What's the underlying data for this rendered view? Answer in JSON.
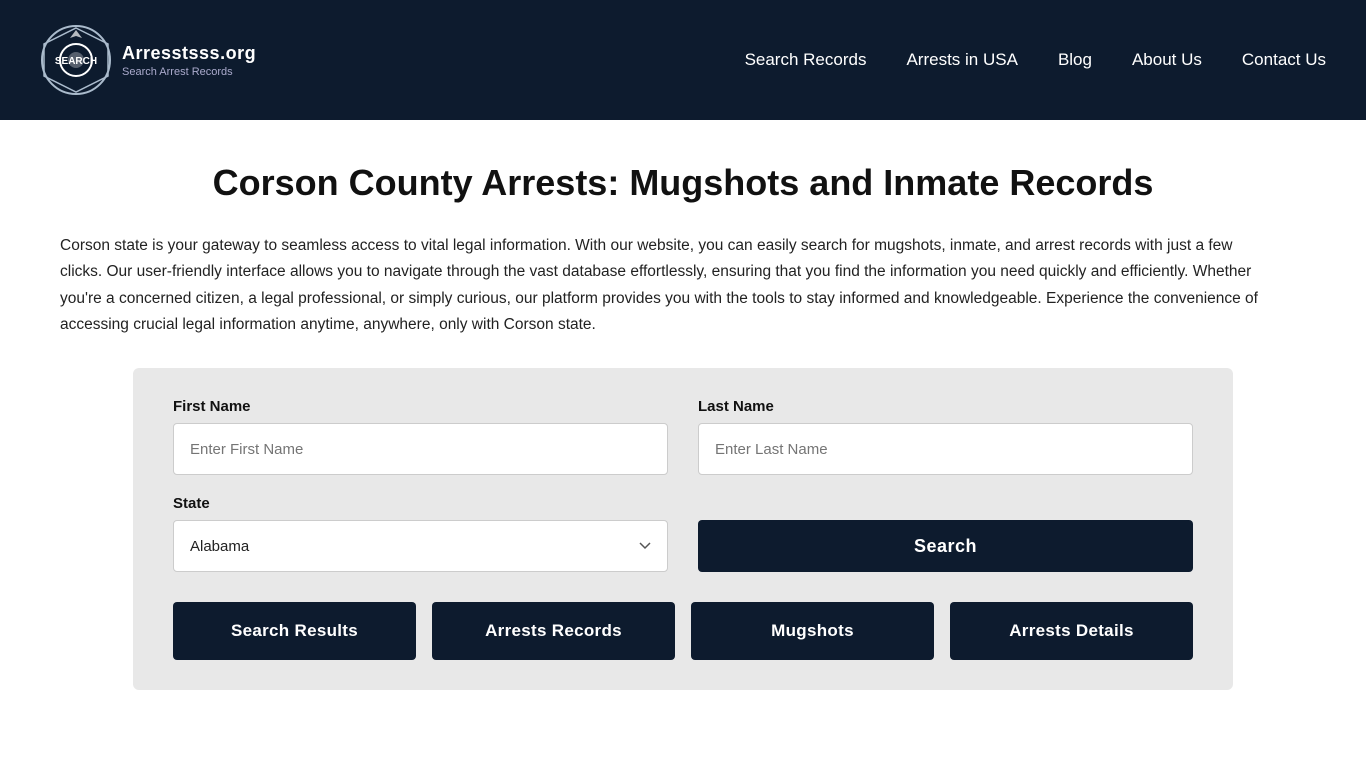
{
  "header": {
    "logo_title": "Arresstsss.org",
    "logo_subtitle": "Search Arrest Records",
    "nav": {
      "search_records": "Search Records",
      "arrests_in_usa": "Arrests in USA",
      "blog": "Blog",
      "about_us": "About Us",
      "contact_us": "Contact Us"
    }
  },
  "main": {
    "page_title": "Corson County Arrests: Mugshots and Inmate Records",
    "description": "Corson state is your gateway to seamless access to vital legal information. With our website, you can easily search for mugshots, inmate, and arrest records with just a few clicks. Our user-friendly interface allows you to navigate through the vast database effortlessly, ensuring that you find the information you need quickly and efficiently. Whether you're a concerned citizen, a legal professional, or simply curious, our platform provides you with the tools to stay informed and knowledgeable. Experience the convenience of accessing crucial legal information anytime, anywhere, only with Corson state.",
    "form": {
      "first_name_label": "First Name",
      "first_name_placeholder": "Enter First Name",
      "last_name_label": "Last Name",
      "last_name_placeholder": "Enter Last Name",
      "state_label": "State",
      "state_default": "Alabama",
      "search_button": "Search"
    },
    "bottom_buttons": {
      "search_results": "Search Results",
      "arrests_records": "Arrests Records",
      "mugshots": "Mugshots",
      "arrests_details": "Arrests Details"
    }
  }
}
